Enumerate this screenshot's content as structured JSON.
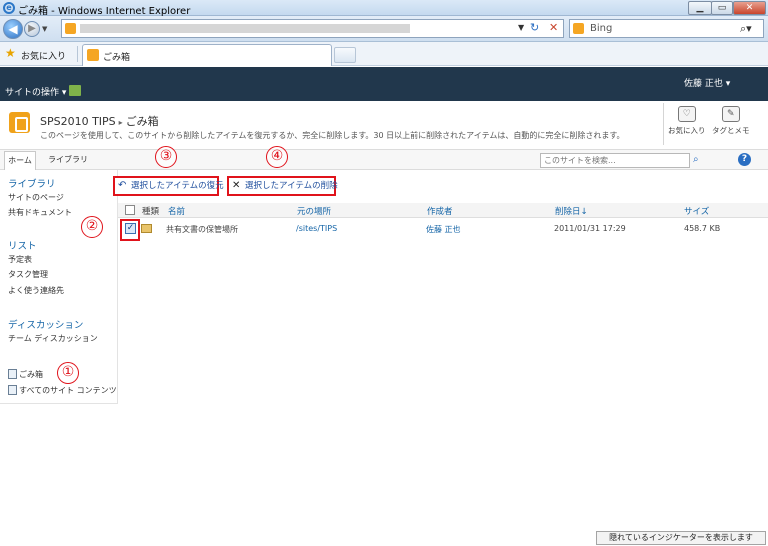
{
  "browser": {
    "title": "ごみ箱 - Windows Internet Explorer",
    "search_provider": "Bing",
    "favorites_label": "お気に入り",
    "tab_title": "ごみ箱",
    "status_indicator": "隠れているインジケーターを表示します"
  },
  "sp": {
    "site_actions": "サイトの操作",
    "user_name": "佐藤 正也",
    "site_title": "SPS2010 TIPS",
    "page_title": "ごみ箱",
    "description": "このページを使用して、このサイトから削除したアイテムを復元するか、完全に削除します。30 日以上前に削除されたアイテムは、自動的に完全に削除されます。",
    "tools": {
      "favorite": "お気に入り",
      "tag": "タグとメモ"
    },
    "tabs": {
      "home": "ホーム",
      "library": "ライブラリ"
    },
    "search_placeholder": "このサイトを検索...",
    "quick_launch": {
      "libraries_heading": "ライブラリ",
      "libraries": [
        "サイトのページ",
        "共有ドキュメント"
      ],
      "lists_heading": "リスト",
      "lists": [
        "予定表",
        "タスク管理",
        "よく使う連絡先"
      ],
      "discussions_heading": "ディスカッション",
      "discussions": [
        "チーム ディスカッション"
      ],
      "recycle_bin": "ごみ箱",
      "all_content": "すべてのサイト コンテンツ"
    },
    "actions": {
      "restore": "選択したアイテムの復元",
      "delete": "選択したアイテムの削除"
    },
    "columns": {
      "type": "種類",
      "name": "名前",
      "location": "元の場所",
      "author": "作成者",
      "deleted": "削除日",
      "size": "サイズ"
    },
    "rows": [
      {
        "name": "共有文書の保管場所",
        "location": "/sites/TIPS",
        "author": "佐藤 正也",
        "deleted": "2011/01/31 17:29",
        "size": "458.7 KB",
        "checked": true
      }
    ]
  },
  "callouts": [
    "①",
    "②",
    "③",
    "④"
  ]
}
